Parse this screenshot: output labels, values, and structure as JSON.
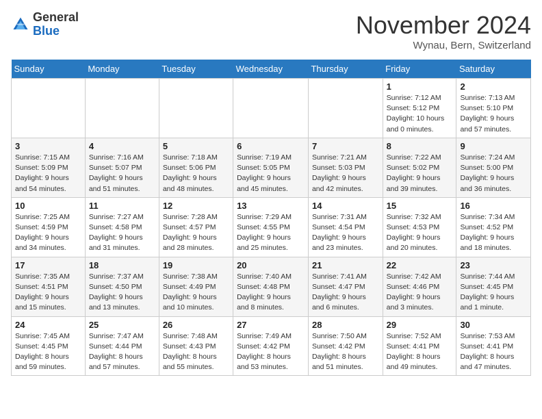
{
  "header": {
    "logo_line1": "General",
    "logo_line2": "Blue",
    "month_title": "November 2024",
    "location": "Wynau, Bern, Switzerland"
  },
  "weekdays": [
    "Sunday",
    "Monday",
    "Tuesday",
    "Wednesday",
    "Thursday",
    "Friday",
    "Saturday"
  ],
  "weeks": [
    [
      {
        "day": "",
        "info": ""
      },
      {
        "day": "",
        "info": ""
      },
      {
        "day": "",
        "info": ""
      },
      {
        "day": "",
        "info": ""
      },
      {
        "day": "",
        "info": ""
      },
      {
        "day": "1",
        "info": "Sunrise: 7:12 AM\nSunset: 5:12 PM\nDaylight: 10 hours\nand 0 minutes."
      },
      {
        "day": "2",
        "info": "Sunrise: 7:13 AM\nSunset: 5:10 PM\nDaylight: 9 hours\nand 57 minutes."
      }
    ],
    [
      {
        "day": "3",
        "info": "Sunrise: 7:15 AM\nSunset: 5:09 PM\nDaylight: 9 hours\nand 54 minutes."
      },
      {
        "day": "4",
        "info": "Sunrise: 7:16 AM\nSunset: 5:07 PM\nDaylight: 9 hours\nand 51 minutes."
      },
      {
        "day": "5",
        "info": "Sunrise: 7:18 AM\nSunset: 5:06 PM\nDaylight: 9 hours\nand 48 minutes."
      },
      {
        "day": "6",
        "info": "Sunrise: 7:19 AM\nSunset: 5:05 PM\nDaylight: 9 hours\nand 45 minutes."
      },
      {
        "day": "7",
        "info": "Sunrise: 7:21 AM\nSunset: 5:03 PM\nDaylight: 9 hours\nand 42 minutes."
      },
      {
        "day": "8",
        "info": "Sunrise: 7:22 AM\nSunset: 5:02 PM\nDaylight: 9 hours\nand 39 minutes."
      },
      {
        "day": "9",
        "info": "Sunrise: 7:24 AM\nSunset: 5:00 PM\nDaylight: 9 hours\nand 36 minutes."
      }
    ],
    [
      {
        "day": "10",
        "info": "Sunrise: 7:25 AM\nSunset: 4:59 PM\nDaylight: 9 hours\nand 34 minutes."
      },
      {
        "day": "11",
        "info": "Sunrise: 7:27 AM\nSunset: 4:58 PM\nDaylight: 9 hours\nand 31 minutes."
      },
      {
        "day": "12",
        "info": "Sunrise: 7:28 AM\nSunset: 4:57 PM\nDaylight: 9 hours\nand 28 minutes."
      },
      {
        "day": "13",
        "info": "Sunrise: 7:29 AM\nSunset: 4:55 PM\nDaylight: 9 hours\nand 25 minutes."
      },
      {
        "day": "14",
        "info": "Sunrise: 7:31 AM\nSunset: 4:54 PM\nDaylight: 9 hours\nand 23 minutes."
      },
      {
        "day": "15",
        "info": "Sunrise: 7:32 AM\nSunset: 4:53 PM\nDaylight: 9 hours\nand 20 minutes."
      },
      {
        "day": "16",
        "info": "Sunrise: 7:34 AM\nSunset: 4:52 PM\nDaylight: 9 hours\nand 18 minutes."
      }
    ],
    [
      {
        "day": "17",
        "info": "Sunrise: 7:35 AM\nSunset: 4:51 PM\nDaylight: 9 hours\nand 15 minutes."
      },
      {
        "day": "18",
        "info": "Sunrise: 7:37 AM\nSunset: 4:50 PM\nDaylight: 9 hours\nand 13 minutes."
      },
      {
        "day": "19",
        "info": "Sunrise: 7:38 AM\nSunset: 4:49 PM\nDaylight: 9 hours\nand 10 minutes."
      },
      {
        "day": "20",
        "info": "Sunrise: 7:40 AM\nSunset: 4:48 PM\nDaylight: 9 hours\nand 8 minutes."
      },
      {
        "day": "21",
        "info": "Sunrise: 7:41 AM\nSunset: 4:47 PM\nDaylight: 9 hours\nand 6 minutes."
      },
      {
        "day": "22",
        "info": "Sunrise: 7:42 AM\nSunset: 4:46 PM\nDaylight: 9 hours\nand 3 minutes."
      },
      {
        "day": "23",
        "info": "Sunrise: 7:44 AM\nSunset: 4:45 PM\nDaylight: 9 hours\nand 1 minute."
      }
    ],
    [
      {
        "day": "24",
        "info": "Sunrise: 7:45 AM\nSunset: 4:45 PM\nDaylight: 8 hours\nand 59 minutes."
      },
      {
        "day": "25",
        "info": "Sunrise: 7:47 AM\nSunset: 4:44 PM\nDaylight: 8 hours\nand 57 minutes."
      },
      {
        "day": "26",
        "info": "Sunrise: 7:48 AM\nSunset: 4:43 PM\nDaylight: 8 hours\nand 55 minutes."
      },
      {
        "day": "27",
        "info": "Sunrise: 7:49 AM\nSunset: 4:42 PM\nDaylight: 8 hours\nand 53 minutes."
      },
      {
        "day": "28",
        "info": "Sunrise: 7:50 AM\nSunset: 4:42 PM\nDaylight: 8 hours\nand 51 minutes."
      },
      {
        "day": "29",
        "info": "Sunrise: 7:52 AM\nSunset: 4:41 PM\nDaylight: 8 hours\nand 49 minutes."
      },
      {
        "day": "30",
        "info": "Sunrise: 7:53 AM\nSunset: 4:41 PM\nDaylight: 8 hours\nand 47 minutes."
      }
    ]
  ]
}
